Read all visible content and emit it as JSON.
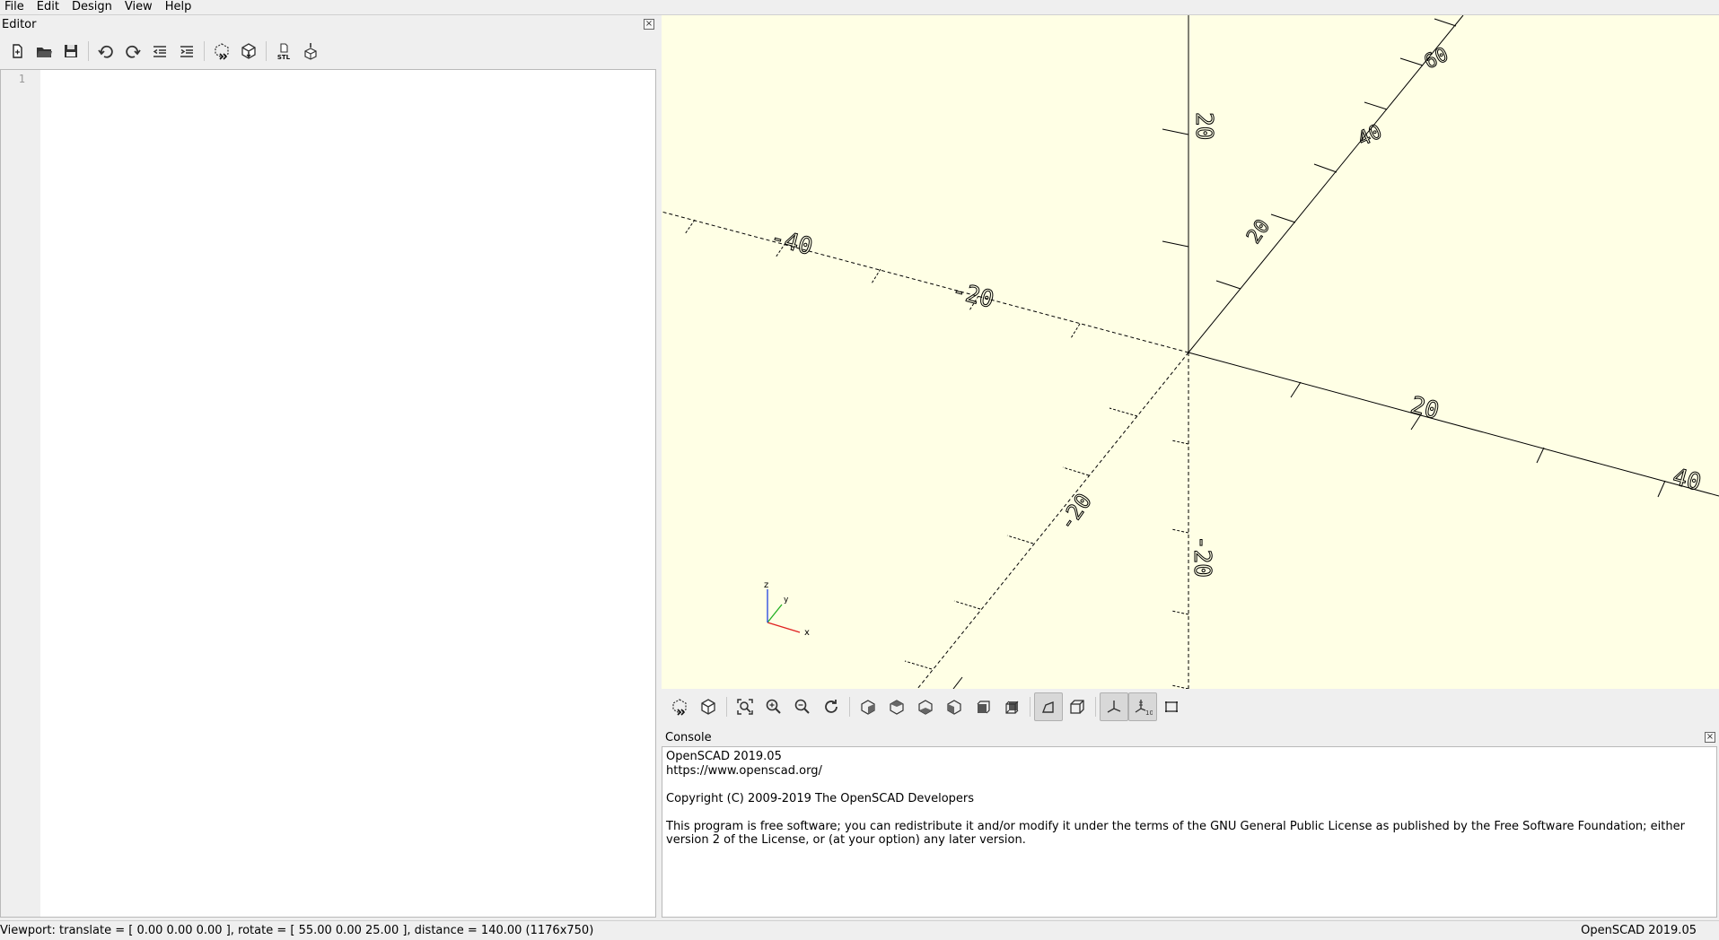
{
  "menu": [
    "File",
    "Edit",
    "Design",
    "View",
    "Help"
  ],
  "editor": {
    "title": "Editor",
    "line_numbers": [
      "1"
    ],
    "toolbar": [
      {
        "icon": "new-file-icon"
      },
      {
        "icon": "open-file-icon"
      },
      {
        "icon": "save-icon"
      },
      {
        "icon": "undo-icon"
      },
      {
        "icon": "redo-icon"
      },
      {
        "icon": "unindent-icon"
      },
      {
        "icon": "indent-icon"
      },
      {
        "icon": "preview-icon"
      },
      {
        "icon": "render-icon"
      },
      {
        "icon": "export-stl-icon",
        "label": "STL"
      },
      {
        "icon": "send-to-printer-icon"
      }
    ]
  },
  "viewport": {
    "axis_labels": {
      "x_pos": [
        "20",
        "40"
      ],
      "x_neg": [
        "-20",
        "-40"
      ],
      "z_pos": "20",
      "z_neg": "-20",
      "y_pos": [
        "20",
        "40",
        "60"
      ],
      "y_neg": "-20"
    },
    "gizmo": {
      "x": "x",
      "y": "y",
      "z": "z"
    },
    "background_color": "#ffffe5"
  },
  "view_toolbar": [
    "preview-icon",
    "render-icon",
    "view-all-icon",
    "zoom-in-icon",
    "zoom-out-icon",
    "reset-view-icon",
    "view-right-icon",
    "view-top-icon",
    "view-bottom-icon",
    "view-left-icon",
    "view-front-icon",
    "view-back-icon",
    "perspective-icon",
    "orthogonal-icon",
    "show-axes-icon",
    "show-scale-markers-icon",
    "show-edges-icon"
  ],
  "console": {
    "title": "Console",
    "lines": [
      "OpenSCAD 2019.05",
      "https://www.openscad.org/",
      "",
      "Copyright (C) 2009-2019 The OpenSCAD Developers",
      "",
      "This program is free software; you can redistribute it and/or modify it under the terms of the GNU General Public License as published by the Free Software Foundation; either version 2 of the License, or (at your option) any later version."
    ]
  },
  "status": {
    "left": "Viewport: translate = [ 0.00 0.00 0.00 ], rotate = [ 55.00 0.00 25.00 ], distance = 140.00 (1176x750)",
    "right": "OpenSCAD 2019.05"
  }
}
